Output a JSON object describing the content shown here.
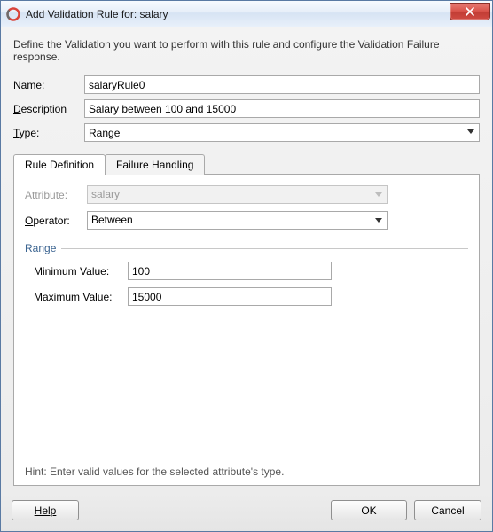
{
  "window": {
    "title": "Add Validation Rule for: salary"
  },
  "intro": "Define the Validation you want to perform with this rule and configure the Validation Failure response.",
  "fields": {
    "name_label_pre": "N",
    "name_label_post": "ame:",
    "name_value": "salaryRule0",
    "desc_label_pre": "D",
    "desc_label_post": "escription",
    "desc_value": "Salary between 100 and 15000",
    "type_label_pre": "T",
    "type_label_post": "ype:",
    "type_value": "Range"
  },
  "tabs": {
    "definition": "Rule Definition",
    "failure": "Failure Handling"
  },
  "panel": {
    "attr_label_pre": "A",
    "attr_label_post": "ttribute:",
    "attr_value": "salary",
    "op_label_pre": "O",
    "op_label_post": "perator:",
    "op_value": "Between",
    "range_label": "Range",
    "min_label_pre": "Minimum ",
    "min_label_mn": "V",
    "min_label_post": "alue:",
    "min_value": "100",
    "max_label_pre": "Ma",
    "max_label_mn": "x",
    "max_label_post": "imum Value:",
    "max_value": "15000",
    "hint": "Hint: Enter valid values for the selected attribute's type."
  },
  "footer": {
    "help": "Help",
    "ok": "OK",
    "cancel": "Cancel"
  }
}
